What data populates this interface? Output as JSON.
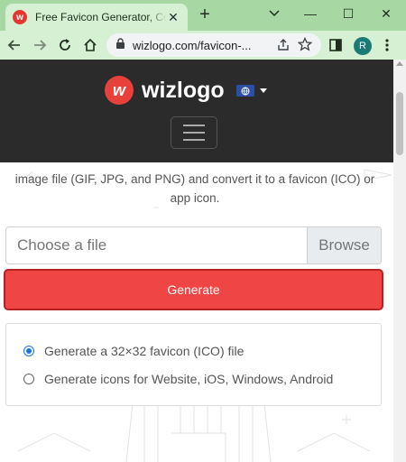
{
  "browser": {
    "tab_title": "Free Favicon Generator, Convert",
    "tab_favicon_letter": "w",
    "url": "wizlogo.com/favicon-...",
    "profile_initial": "R",
    "controls": {
      "minimize": "—",
      "maximize": "☐",
      "close": "✕",
      "new_tab": "+"
    }
  },
  "site": {
    "logo_mark": "w",
    "brand": "wizlogo",
    "lead_text": "image file (GIF, JPG, and PNG) and convert it to a favicon (ICO) or app icon.",
    "file_placeholder": "Choose a file",
    "browse_label": "Browse",
    "generate_label": "Generate",
    "options": [
      {
        "label": "Generate a 32×32 favicon (ICO) file",
        "checked": true
      },
      {
        "label": "Generate icons for Website, iOS, Windows, Android",
        "checked": false
      }
    ]
  },
  "colors": {
    "accent": "#f04545",
    "header_bg": "#2b2b2b",
    "chrome_frame": "#a7d7a3"
  }
}
